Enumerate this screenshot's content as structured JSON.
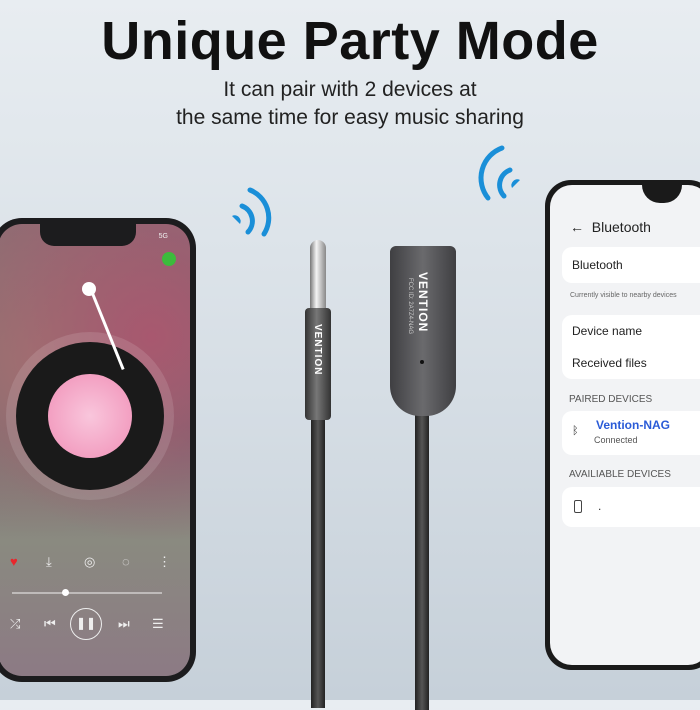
{
  "heading": {
    "title": "Unique Party Mode",
    "subtitle_line1": "It can pair with 2 devices at",
    "subtitle_line2": "the same time for easy music sharing"
  },
  "colors": {
    "accent": "#1a8fd8",
    "link": "#2a5bd7",
    "wechat": "#3cbb3c",
    "heart": "#e8262c"
  },
  "left_phone": {
    "status": "5G",
    "controls": {
      "heart": "heart-icon",
      "download": "download-icon",
      "shuffle": "shuffle-icon",
      "prev": "previous-icon",
      "pause": "pause-icon",
      "next": "next-icon",
      "playlist": "playlist-icon"
    },
    "progress": 0.35
  },
  "product": {
    "jack_brand": "VENTION",
    "dongle_brand": "VENTION",
    "fcc": "FCC ID: 2A7Z4-NAG"
  },
  "right_phone": {
    "header": "Bluetooth",
    "bluetooth_row": "Bluetooth",
    "visible_note": "Currently visible to nearby devices",
    "device_name": "Device name",
    "received_files": "Received files",
    "paired_header": "PAIRED DEVICES",
    "paired_device": {
      "name": "Vention-NAG",
      "status": "Connected"
    },
    "available_header": "AVAILIABLE DEVICES",
    "available_device": "."
  }
}
